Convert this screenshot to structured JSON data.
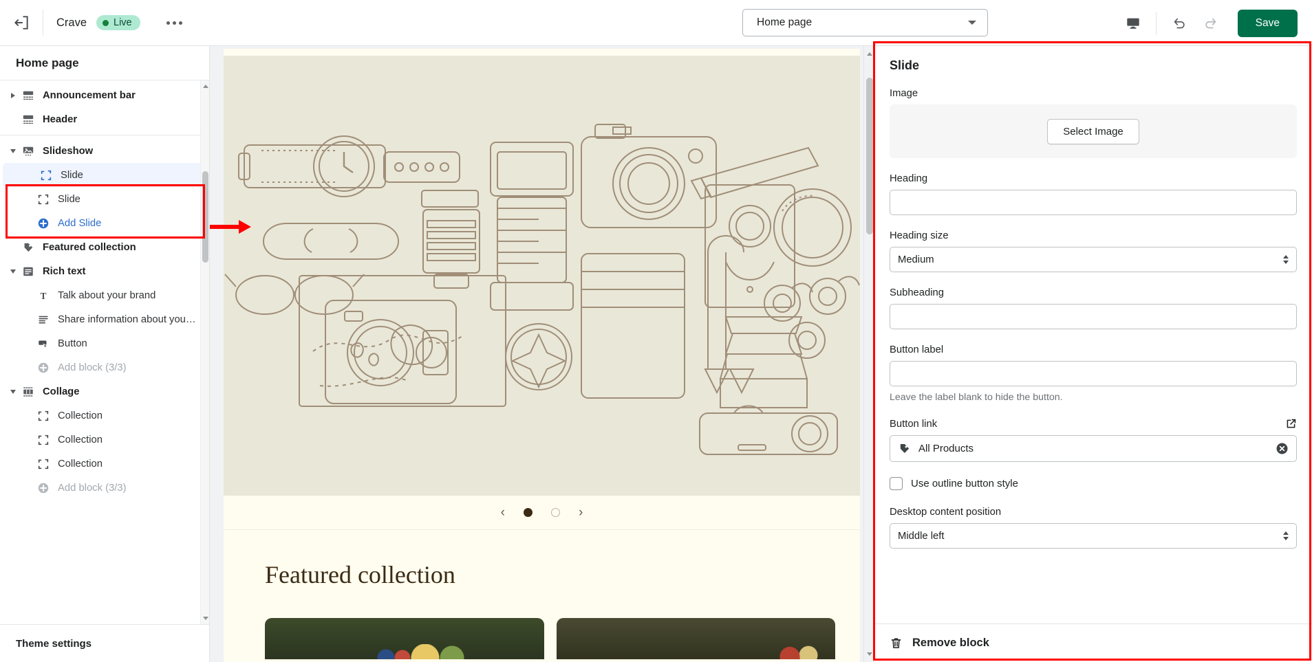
{
  "topbar": {
    "exit_icon": "exit-arrow-icon",
    "store_name": "Crave",
    "status_badge": "Live",
    "more_icon": "more-horizontal-icon",
    "page_selector_value": "Home page",
    "device_icon": "desktop-icon",
    "undo_icon": "undo-icon",
    "redo_icon": "redo-icon",
    "save_label": "Save"
  },
  "sidebar": {
    "title": "Home page",
    "footer_label": "Theme settings",
    "items": [
      {
        "label": "Announcement bar",
        "level": "section",
        "icon": "announcement-bar-icon",
        "toggle": "collapsed"
      },
      {
        "label": "Header",
        "level": "section",
        "icon": "header-icon",
        "toggle": "none"
      },
      {
        "label": "Slideshow",
        "level": "section",
        "icon": "slideshow-image-icon",
        "toggle": "expanded"
      },
      {
        "label": "Slide",
        "level": "block",
        "icon": "block-icon",
        "state": "selected"
      },
      {
        "label": "Slide",
        "level": "block",
        "icon": "block-icon",
        "state": "normal"
      },
      {
        "label": "Add Slide",
        "level": "block",
        "icon": "plus-circle-icon",
        "state": "link"
      },
      {
        "label": "Featured collection",
        "level": "section",
        "icon": "tag-icon",
        "toggle": "none"
      },
      {
        "label": "Rich text",
        "level": "section",
        "icon": "rich-text-icon",
        "toggle": "expanded"
      },
      {
        "label": "Talk about your brand",
        "level": "block",
        "icon": "text-heading-icon",
        "state": "normal"
      },
      {
        "label": "Share information about your ...",
        "level": "block",
        "icon": "paragraph-icon",
        "state": "normal"
      },
      {
        "label": "Button",
        "level": "block",
        "icon": "button-icon",
        "state": "normal"
      },
      {
        "label": "Add block (3/3)",
        "level": "block",
        "icon": "plus-circle-icon",
        "state": "muted"
      },
      {
        "label": "Collage",
        "level": "section",
        "icon": "collage-icon",
        "toggle": "expanded"
      },
      {
        "label": "Collection",
        "level": "block",
        "icon": "block-icon",
        "state": "normal"
      },
      {
        "label": "Collection",
        "level": "block",
        "icon": "block-icon",
        "state": "normal"
      },
      {
        "label": "Collection",
        "level": "block",
        "icon": "block-icon",
        "state": "normal"
      },
      {
        "label": "Add block (3/3)",
        "level": "block",
        "icon": "plus-circle-icon",
        "state": "muted"
      }
    ]
  },
  "preview": {
    "slider_prev_icon": "chevron-left-icon",
    "slider_next_icon": "chevron-right-icon",
    "slide_dots": [
      "active",
      "idle"
    ],
    "featured_title": "Featured collection"
  },
  "right_panel": {
    "title": "Slide",
    "image_label": "Image",
    "select_image_label": "Select Image",
    "heading_label": "Heading",
    "heading_value": "",
    "heading_size_label": "Heading size",
    "heading_size_value": "Medium",
    "subheading_label": "Subheading",
    "subheading_value": "",
    "button_label_label": "Button label",
    "button_label_value": "",
    "button_label_help": "Leave the label blank to hide the button.",
    "button_link_label": "Button link",
    "button_link_external_icon": "external-link-icon",
    "button_link_icon": "tag-icon",
    "button_link_value": "All Products",
    "button_link_clear_icon": "clear-circle-icon",
    "outline_checkbox_label": "Use outline button style",
    "outline_checkbox_checked": false,
    "desktop_position_label": "Desktop content position",
    "desktop_position_value": "Middle left",
    "remove_block_icon": "trash-icon",
    "remove_block_label": "Remove block"
  },
  "annotations": {
    "highlight_color": "#ff0000"
  }
}
